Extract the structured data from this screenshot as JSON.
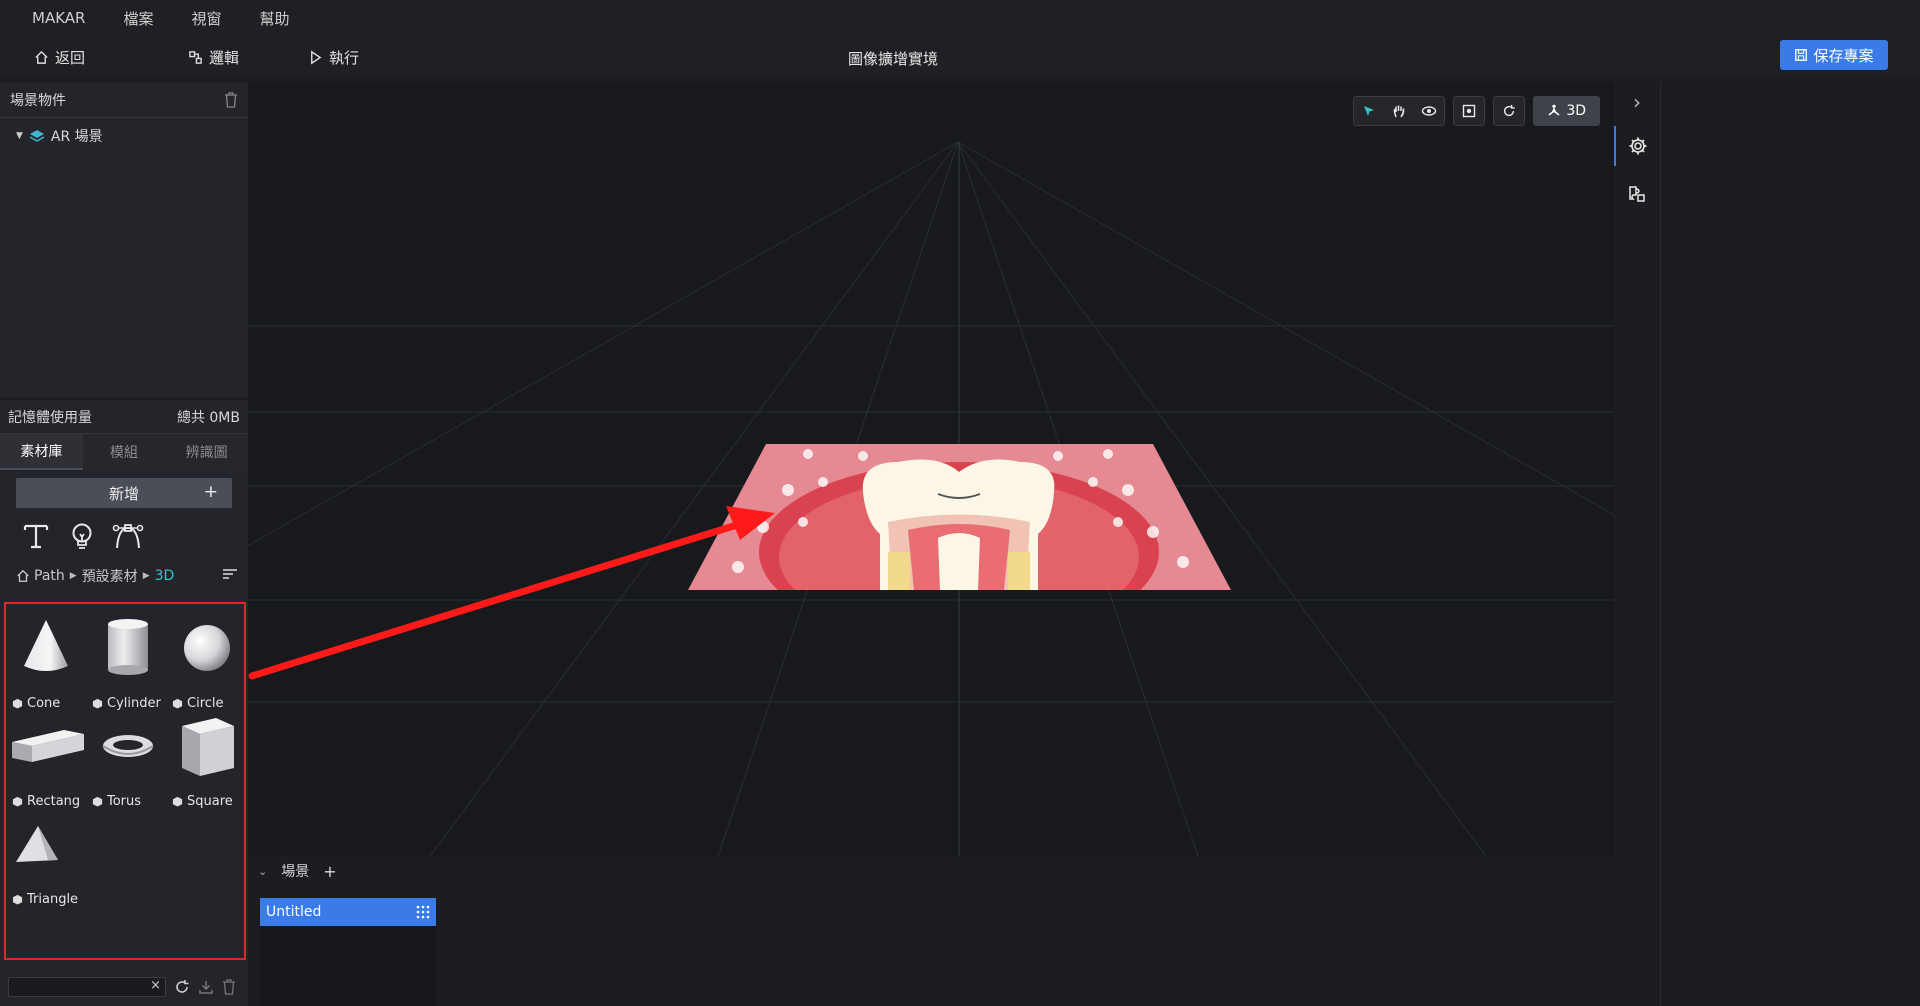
{
  "menubar": {
    "items": [
      "MAKAR",
      "檔案",
      "視窗",
      "幫助"
    ]
  },
  "toolbar": {
    "back_label": "返回",
    "logic_label": "邏輯",
    "run_label": "執行",
    "project_title": "圖像擴增實境",
    "save_label": "保存專案"
  },
  "scene_objects": {
    "title": "場景物件",
    "items": [
      {
        "label": "AR 場景"
      }
    ]
  },
  "memory": {
    "label": "記憶體使用量",
    "total": "總共 0MB"
  },
  "tabs": [
    {
      "label": "素材庫",
      "active": true
    },
    {
      "label": "模組",
      "active": false
    },
    {
      "label": "辨識圖",
      "active": false
    }
  ],
  "asset_panel": {
    "add_label": "新增",
    "add_plus": "+",
    "path": [
      "Path",
      "預設素材",
      "3D"
    ],
    "assets": [
      {
        "label": "Cone",
        "shape": "cone"
      },
      {
        "label": "Cylinder",
        "shape": "cylinder"
      },
      {
        "label": "Circle",
        "shape": "sphere"
      },
      {
        "label": "Rectang",
        "shape": "box"
      },
      {
        "label": "Torus",
        "shape": "torus"
      },
      {
        "label": "Square",
        "shape": "cube"
      },
      {
        "label": "Triangle",
        "shape": "triangle"
      }
    ],
    "search_clear": "×"
  },
  "viewport": {
    "mode_label": "3D"
  },
  "scenes": {
    "label": "場景",
    "add": "+",
    "items": [
      {
        "label": "Untitled",
        "active": true
      }
    ]
  },
  "colors": {
    "accent": "#3a7be8",
    "path_active": "#33c4c6",
    "highlight_border": "#e02828",
    "arrow": "#ff1a1a"
  }
}
